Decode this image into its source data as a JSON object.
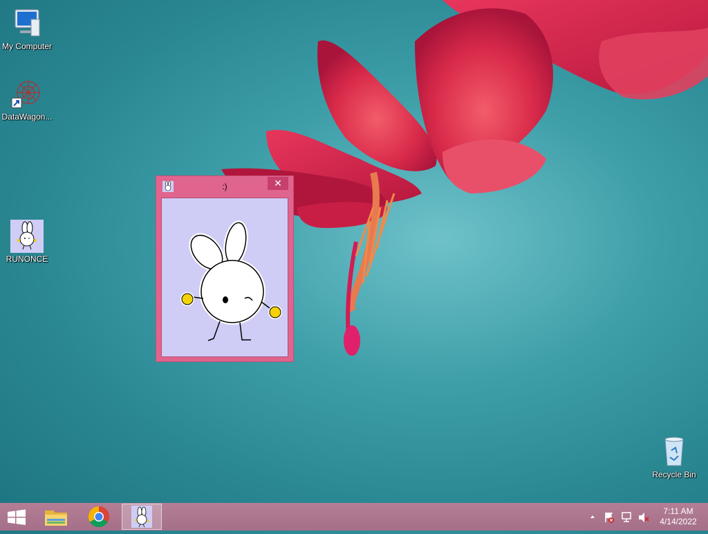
{
  "desktop": {
    "icons": [
      {
        "label": "My Computer"
      },
      {
        "label": "DataWagon..."
      },
      {
        "label": "RUNONCE"
      },
      {
        "label": "Recycle Bin"
      }
    ]
  },
  "window": {
    "title": ":)",
    "close_glyph": "✕"
  },
  "taskbar": {
    "start_icon": "windows-logo-icon",
    "pinned": [
      "file-explorer-icon",
      "chrome-icon",
      "bunny-app-icon"
    ]
  },
  "tray": {
    "icons": [
      "show-hidden-icons-chevron",
      "action-center-flag-icon",
      "network-icon",
      "volume-muted-icon"
    ],
    "time": "7:11 AM",
    "date": "4/14/2022"
  },
  "colors": {
    "window_frame": "#e0658e",
    "window_client": "#cfcdf6",
    "close_button": "#c73f6c",
    "taskbar": "#a9728c"
  }
}
